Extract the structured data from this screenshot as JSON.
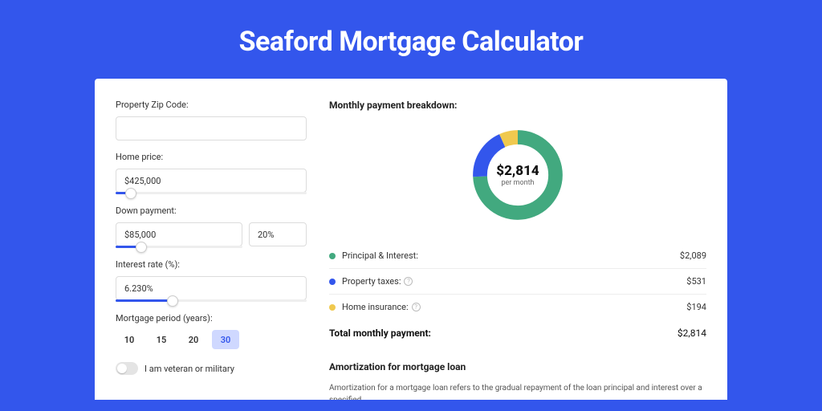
{
  "title": "Seaford Mortgage Calculator",
  "form": {
    "zip_label": "Property Zip Code:",
    "zip_value": "",
    "home_price_label": "Home price:",
    "home_price_value": "$425,000",
    "home_price_slider_pct": 8,
    "down_payment_label": "Down payment:",
    "down_payment_value": "$85,000",
    "down_payment_pct_value": "20%",
    "down_payment_slider_pct": 20,
    "interest_label": "Interest rate (%):",
    "interest_value": "6.230%",
    "interest_slider_pct": 30,
    "period_label": "Mortgage period (years):",
    "period_options": [
      "10",
      "15",
      "20",
      "30"
    ],
    "period_selected": "30",
    "veteran_label": "I am veteran or military"
  },
  "breakdown": {
    "title": "Monthly payment breakdown:",
    "center_value": "$2,814",
    "center_sub": "per month",
    "items": [
      {
        "label": "Principal & Interest:",
        "amount": "$2,089",
        "color": "#42a97f",
        "has_help": false
      },
      {
        "label": "Property taxes:",
        "amount": "$531",
        "color": "#3356ec",
        "has_help": true
      },
      {
        "label": "Home insurance:",
        "amount": "$194",
        "color": "#f0c94f",
        "has_help": true
      }
    ],
    "total_label": "Total monthly payment:",
    "total_amount": "$2,814"
  },
  "chart_data": {
    "type": "pie",
    "title": "Monthly payment breakdown",
    "series": [
      {
        "name": "Principal & Interest",
        "value": 2089,
        "color": "#42a97f"
      },
      {
        "name": "Property taxes",
        "value": 531,
        "color": "#3356ec"
      },
      {
        "name": "Home insurance",
        "value": 194,
        "color": "#f0c94f"
      }
    ],
    "total": 2814,
    "units": "USD per month"
  },
  "amortization": {
    "title": "Amortization for mortgage loan",
    "text": "Amortization for a mortgage loan refers to the gradual repayment of the loan principal and interest over a specified"
  }
}
